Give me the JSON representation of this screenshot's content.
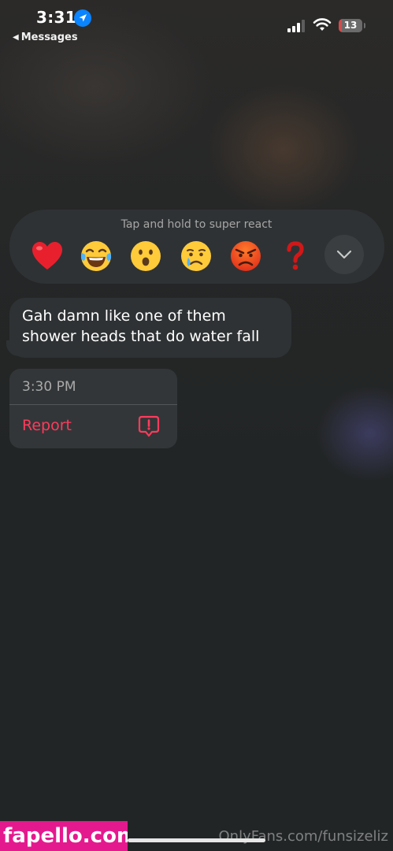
{
  "status_bar": {
    "time": "3:31",
    "back_label": "Messages",
    "battery_level": "13",
    "battery_fraction": 0.13
  },
  "reactions": {
    "hint": "Tap and hold to super react",
    "items": [
      "heart",
      "laughing-with-tears",
      "surprised",
      "crying",
      "angry",
      "question-mark"
    ],
    "more_icon": "chevron-down"
  },
  "message": {
    "text": "Gah damn like one of them shower heads that do water fall"
  },
  "menu": {
    "time": "3:30 PM",
    "report_label": "Report",
    "report_icon": "exclamation-bubble"
  },
  "watermarks": {
    "source": "OnlyFans.com/funsizeliz",
    "site": "fapello.com"
  },
  "colors": {
    "accent_red": "#ff3b5c",
    "location_blue": "#0a84ff",
    "battery_low": "#d24b4b",
    "badge_pink": "#e5198e"
  }
}
